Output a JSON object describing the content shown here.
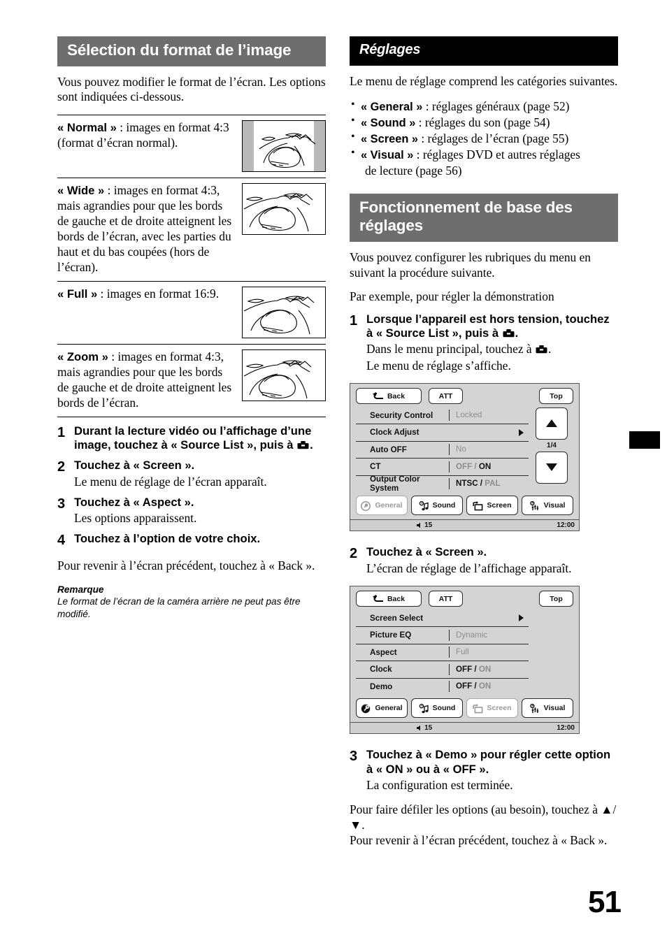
{
  "page": {
    "number": "51"
  },
  "left": {
    "header": "Sélection du format de l’image",
    "intro": "Vous pouvez modifier le format de l’écran. Les options sont indiquées ci-dessous.",
    "options": [
      {
        "name": "« Normal »",
        "desc": " : images en format 4:3 (format d’écran normal).",
        "illustration": "normal-pillarbox"
      },
      {
        "name": "« Wide »",
        "desc": " : images en format 4:3, mais agrandies pour que les bords de gauche et de droite atteignent les bords de l’écran, avec les parties du haut et du bas coupées (hors de l’écran).",
        "illustration": "wide-fullframe"
      },
      {
        "name": "« Full »",
        "desc": " : images en format 16:9.",
        "illustration": "full-fullframe"
      },
      {
        "name": "« Zoom »",
        "desc": " : images en format 4:3, mais agrandies pour que les bords de gauche et de droite atteignent les bords de l’écran.",
        "illustration": "zoom-fullframe"
      }
    ],
    "steps": [
      {
        "num": "1",
        "head_a": "Durant la lecture vidéo ou l’affichage d’une image, touchez à « Source List », puis à ",
        "head_b": ".",
        "sub": ""
      },
      {
        "num": "2",
        "head_a": "Touchez à « Screen ».",
        "head_b": "",
        "sub": "Le menu de réglage de l’écran apparaît."
      },
      {
        "num": "3",
        "head_a": "Touchez à « Aspect ».",
        "head_b": "",
        "sub": "Les options apparaissent."
      },
      {
        "num": "4",
        "head_a": "Touchez à l’option de votre choix.",
        "head_b": "",
        "sub": ""
      }
    ],
    "after_steps": "Pour revenir à l’écran précédent, touchez à « Back ».",
    "note_title": "Remarque",
    "note_body": "Le format de l’écran de la caméra arrière ne peut pas être modifié."
  },
  "right": {
    "header_settings": "Réglages",
    "settings_intro": "Le menu de réglage comprend les catégories suivantes.",
    "categories": [
      {
        "name": "« General »",
        "desc": " : réglages généraux (page 52)"
      },
      {
        "name": "« Sound »",
        "desc": " : réglages du son (page 54)"
      },
      {
        "name": "« Screen »",
        "desc": " : réglages de l’écran (page 55)"
      },
      {
        "name": "« Visual »",
        "desc": " : réglages DVD et autres réglages",
        "desc2": "de lecture (page 56)"
      }
    ],
    "header_basic": "Fonctionnement de base des réglages",
    "basic_intro": "Vous pouvez configurer les rubriques du menu en suivant la procédure suivante.",
    "basic_example": "Par exemple, pour régler la démonstration",
    "step1": {
      "num": "1",
      "head_a": "Lorsque l’appareil est hors tension, touchez à « Source List », puis à ",
      "head_b": ".",
      "sub_a": "Dans le menu principal, touchez à ",
      "sub_b": ".",
      "sub2": "Le menu de réglage s’affiche."
    },
    "step2": {
      "num": "2",
      "head": "Touchez à « Screen ».",
      "sub": "L’écran de réglage de l’affichage apparaît."
    },
    "step3": {
      "num": "3",
      "head": "Touchez à « Demo » pour régler cette option à « ON » ou à « OFF ».",
      "sub": "La configuration est terminée."
    },
    "closing1_a": "Pour faire défiler les options (au besoin), touchez à ",
    "closing1_b": "/",
    "closing1_c": ".",
    "closing2": "Pour revenir à l’écran précédent, touchez à « Back »."
  },
  "screen_general": {
    "back_label": "Back",
    "att_label": "ATT",
    "top_label": "Top",
    "page_indicator": "1/4",
    "rows": [
      {
        "label": "Security Control",
        "value": "Locked",
        "state": "dim",
        "caret": ""
      },
      {
        "label": "Clock Adjust",
        "value": "",
        "state": "none",
        "caret": "▶"
      },
      {
        "label": "Auto OFF",
        "value": "No",
        "state": "dim",
        "caret": ""
      },
      {
        "label": "CT",
        "value_off": "OFF",
        "value_sep": " / ",
        "value_on": "ON",
        "state": "split-off-dim",
        "caret": ""
      },
      {
        "label": "Output Color System",
        "value_off": "NTSC",
        "value_sep": " / ",
        "value_on": "PAL",
        "state": "split-first-active",
        "caret": ""
      }
    ],
    "tabs": [
      {
        "label": "General",
        "icon": "general-icon",
        "disabled": true
      },
      {
        "label": "Sound",
        "icon": "sound-icon",
        "disabled": false
      },
      {
        "label": "Screen",
        "icon": "screen-icon",
        "disabled": false
      },
      {
        "label": "Visual",
        "icon": "visual-icon",
        "disabled": false
      }
    ],
    "status": {
      "volume": "15",
      "clock": "12:00"
    }
  },
  "screen_screen": {
    "back_label": "Back",
    "att_label": "ATT",
    "top_label": "Top",
    "rows": [
      {
        "label": "Screen Select",
        "value": "",
        "state": "none",
        "caret": "▶"
      },
      {
        "label": "Picture EQ",
        "value": "Dynamic",
        "state": "dim",
        "caret": ""
      },
      {
        "label": "Aspect",
        "value": "Full",
        "state": "dim",
        "caret": ""
      },
      {
        "label": "Clock",
        "value_off": "OFF",
        "value_sep": " / ",
        "value_on": "ON",
        "state": "split-first-active",
        "caret": ""
      },
      {
        "label": "Demo",
        "value_off": "OFF",
        "value_sep": " / ",
        "value_on": "ON",
        "state": "split-first-active",
        "caret": ""
      }
    ],
    "tabs": [
      {
        "label": "General",
        "icon": "general-icon",
        "disabled": false
      },
      {
        "label": "Sound",
        "icon": "sound-icon",
        "disabled": false
      },
      {
        "label": "Screen",
        "icon": "screen-icon",
        "disabled": true
      },
      {
        "label": "Visual",
        "icon": "visual-icon",
        "disabled": false
      }
    ],
    "status": {
      "volume": "15",
      "clock": "12:00"
    }
  },
  "colors": {
    "header_gray": "#6e6e6e",
    "header_black": "#000000",
    "screen_bg": "#d4d4d4",
    "dim_text": "#8e8e8e"
  }
}
